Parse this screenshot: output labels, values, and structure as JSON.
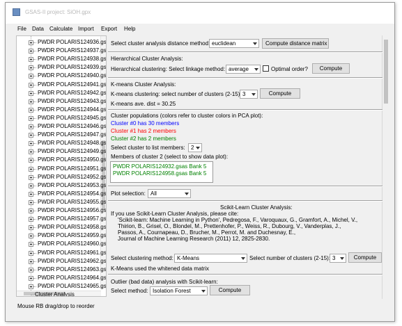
{
  "window": {
    "title": "GSAS-II project: SiOH.gpx"
  },
  "menu": [
    "File",
    "Data",
    "Calculate",
    "Import",
    "Export",
    "Help"
  ],
  "tree": {
    "items": [
      "PWDR POLARIS124936.gs",
      "PWDR POLARIS124937.gs",
      "PWDR POLARIS124938.gs",
      "PWDR POLARIS124939.gs",
      "PWDR POLARIS124940.gs",
      "PWDR POLARIS124941.gs",
      "PWDR POLARIS124942.gs",
      "PWDR POLARIS124943.gs",
      "PWDR POLARIS124944.gs",
      "PWDR POLARIS124945.gs",
      "PWDR POLARIS124946.gs",
      "PWDR POLARIS124947.gs",
      "PWDR POLARIS124948.gs",
      "PWDR POLARIS124949.gs",
      "PWDR POLARIS124950.gs",
      "PWDR POLARIS124951.gs",
      "PWDR POLARIS124952.gs",
      "PWDR POLARIS124953.gs",
      "PWDR POLARIS124954.gs",
      "PWDR POLARIS124955.gs",
      "PWDR POLARIS124956.gs",
      "PWDR POLARIS124957.gs",
      "PWDR POLARIS124958.gs",
      "PWDR POLARIS124959.gs",
      "PWDR POLARIS124960.gs",
      "PWDR POLARIS124961.gs",
      "PWDR POLARIS124962.gs",
      "PWDR POLARIS124963.gs",
      "PWDR POLARIS124964.gs",
      "PWDR POLARIS124965.gs"
    ],
    "last_item": "Cluster Analysis"
  },
  "status": "Mouse RB drag/drop to reorder",
  "distance": {
    "label": "Select cluster analysis distance method:",
    "value": "euclidean",
    "button": "Compute distance matrix"
  },
  "hierarchical": {
    "heading": "Hierarchical Cluster Analysis:",
    "label": "Hierarchical clustering: Select linkage method:",
    "value": "average",
    "checkbox_label": "Optimal order?",
    "button": "Compute"
  },
  "kmeans": {
    "heading": "K-means Cluster Analysis:",
    "label": "K-means clustering: select number of clusters (2-15):",
    "value": "3",
    "button": "Compute",
    "result": "K-means ave. dist = 30.25"
  },
  "populations": {
    "heading": "Cluster populations (colors refer to cluster colors in PCA plot):",
    "lines": [
      "Cluster #0 has 30 members",
      "Cluster #1 has 2 members",
      "Cluster #2 has 2 members"
    ],
    "colors": [
      "#0000ff",
      "#ff0000",
      "#008000"
    ],
    "select_label": "Select cluster to list members:",
    "select_value": "2",
    "members_label": "Members of cluster 2 (select to show data plot):",
    "members": [
      "PWDR POLARIS124932.gsas Bank 5",
      "PWDR POLARIS124958.gsas Bank 5"
    ]
  },
  "plot": {
    "label": "Plot selection:",
    "value": "All"
  },
  "sklearn": {
    "heading": "Scikit-Learn Cluster Analysis:",
    "cite": [
      "If you use Scikit-Learn Cluster Analysis, please cite:",
      "'Scikit-learn: Machine Learning in Python', Pedregosa, F., Varoquaux, G., Gramfort, A., Michel, V.,",
      "Thirion, B., Grisel, O., Blondel, M., Prettenhofer, P., Weiss, R., Dubourg, V., Vanderplas, J.,",
      "Passos, A., Cournapeau, D., Brucher, M., Perrot, M. and Duchesnay, E.,",
      "Journal of Machine Learning Research (2011) 12, 2825-2830."
    ],
    "method_label": "Select clustering method:",
    "method_value": "K-Means",
    "nclusters_label": "Select number of clusters (2-15):",
    "nclusters_value": "3",
    "button": "Compute",
    "note": "K-Means used the whitened data matrix"
  },
  "outlier": {
    "heading": "Outlier (bad data) analysis with Scikit-learn:",
    "label": "Select method:",
    "value": "Isolation Forest",
    "button": "Compute"
  }
}
